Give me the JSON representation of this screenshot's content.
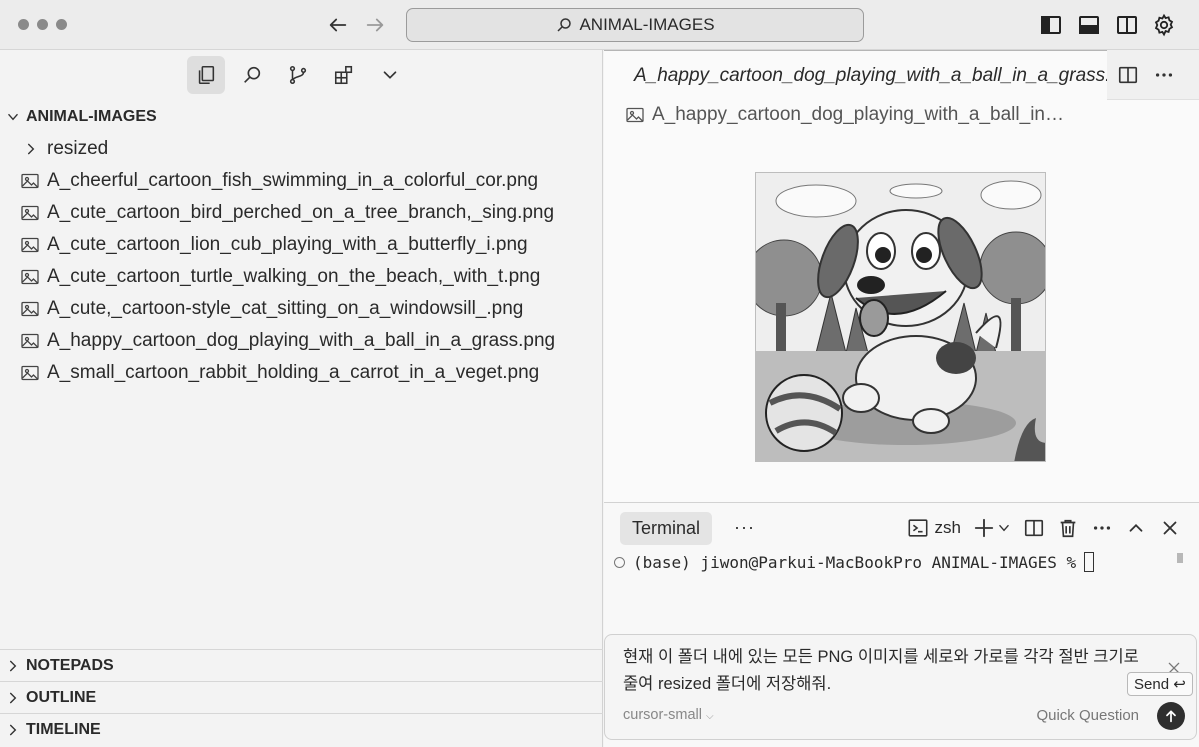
{
  "titlebar": {
    "search_label": "ANIMAL-IMAGES"
  },
  "sidebar": {
    "root_label": "ANIMAL-IMAGES",
    "folder": "resized",
    "files": [
      "A_cheerful_cartoon_fish_swimming_in_a_colorful_cor.png",
      "A_cute_cartoon_bird_perched_on_a_tree_branch,_sing.png",
      "A_cute_cartoon_lion_cub_playing_with_a_butterfly_i.png",
      "A_cute_cartoon_turtle_walking_on_the_beach,_with_t.png",
      "A_cute,_cartoon-style_cat_sitting_on_a_windowsill_.png",
      "A_happy_cartoon_dog_playing_with_a_ball_in_a_grass.png",
      "A_small_cartoon_rabbit_holding_a_carrot_in_a_veget.png"
    ],
    "bottom_sections": [
      "NOTEPADS",
      "OUTLINE",
      "TIMELINE"
    ]
  },
  "editor": {
    "tab_label": "A_happy_cartoon_dog_playing_with_a_ball_in_a_grass.png",
    "breadcrumb": "A_happy_cartoon_dog_playing_with_a_ball_in…"
  },
  "terminal": {
    "tab_label": "Terminal",
    "ellipsis": "···",
    "shell": "zsh",
    "prompt": "(base) jiwon@Parkui-MacBookPro ANIMAL-IMAGES %"
  },
  "composer": {
    "text": "현재 이 폴더 내에 있는 모든 PNG 이미지를 세로와 가로를 각각 절반 크기로 줄여 resized 폴더에 저장해줘.",
    "model": "cursor-small",
    "quick_question": "Quick Question",
    "tooltip": "Send ↩"
  }
}
